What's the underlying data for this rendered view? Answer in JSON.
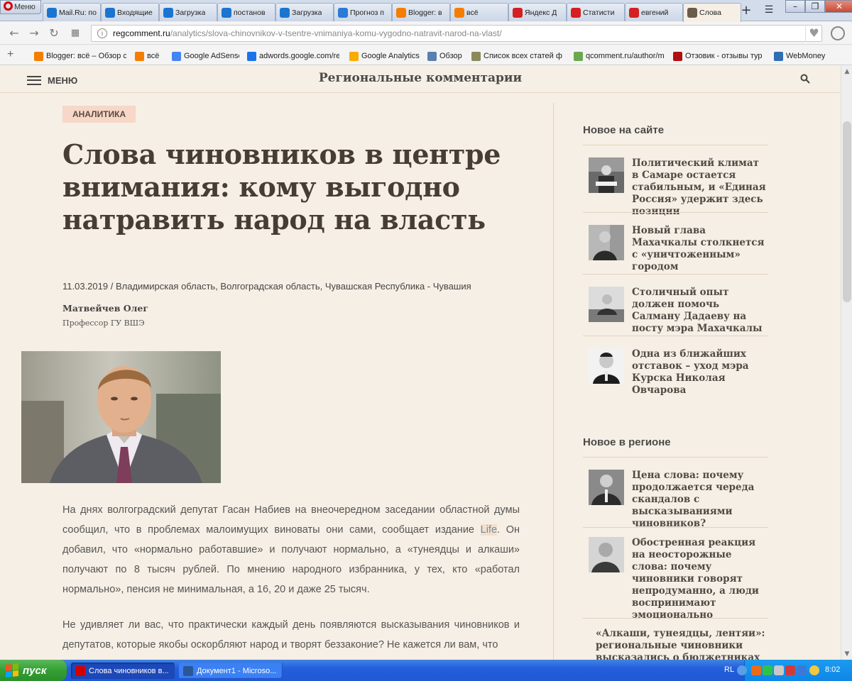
{
  "browser": {
    "menu_label": "Меню",
    "tabs": [
      {
        "label": "Mail.Ru: по",
        "icon": "mail-at-icon",
        "color": "#1b75d0"
      },
      {
        "label": "Входящие",
        "icon": "mail-at-icon",
        "color": "#1b75d0"
      },
      {
        "label": "Загрузка",
        "icon": "mail-at-icon",
        "color": "#1b75d0"
      },
      {
        "label": "постанов",
        "icon": "mail-at-icon",
        "color": "#1b75d0"
      },
      {
        "label": "Загрузка",
        "icon": "mail-at-icon",
        "color": "#1b75d0"
      },
      {
        "label": "Прогноз п",
        "icon": "weather-icon",
        "color": "#2a7ad8"
      },
      {
        "label": "Blogger: в",
        "icon": "blogger-icon",
        "color": "#f57d00"
      },
      {
        "label": "всё",
        "icon": "blogger-icon",
        "color": "#f57d00"
      },
      {
        "label": "Яндекс Д",
        "icon": "yandex-icon",
        "color": "#d42020"
      },
      {
        "label": "Статисти",
        "icon": "yandex-icon",
        "color": "#d42020"
      },
      {
        "label": "евгений",
        "icon": "yandex-icon",
        "color": "#d42020"
      },
      {
        "label": "Слова",
        "icon": "rk-site-icon",
        "color": "#6b5b4b"
      }
    ],
    "url_host": "regcomment.ru",
    "url_path": "/analytics/slova-chinovnikov-v-tsentre-vnimaniya-komu-vygodno-natravit-narod-na-vlast/",
    "bookmarks": [
      {
        "label": "Blogger: всё – Обзор ст",
        "icon": "blogger-icon",
        "color": "#f57d00"
      },
      {
        "label": "всё",
        "icon": "blogger-icon",
        "color": "#f57d00"
      },
      {
        "label": "Google AdSense",
        "icon": "adsense-icon",
        "color": "#4285f4"
      },
      {
        "label": "adwords.google.com/re",
        "icon": "adwords-icon",
        "color": "#1a73e8"
      },
      {
        "label": "Google Analytics",
        "icon": "analytics-icon",
        "color": "#f9ab00"
      },
      {
        "label": "Обзор",
        "icon": "overview-icon",
        "color": "#5a7fb0"
      },
      {
        "label": "Список всех статей ф",
        "icon": "list-icon",
        "color": "#8a8a5a"
      },
      {
        "label": "qcomment.ru/author/m",
        "icon": "qcomment-icon",
        "color": "#6aa84f"
      },
      {
        "label": "Отзовик - отзывы тур",
        "icon": "otzovik-icon",
        "color": "#b01010"
      },
      {
        "label": "WebMoney",
        "icon": "webmoney-icon",
        "color": "#2f6db5"
      }
    ]
  },
  "site": {
    "menu_label": "МЕНЮ",
    "title": "Региональные комментарии"
  },
  "article": {
    "category": "АНАЛИТИКА",
    "title": "Слова чиновников в центре внимания: кому выгодно натравить народ на власть",
    "date": "11.03.2019",
    "regions": "Владимирская область, Волгоградская область, Чувашская Республика - Чувашия",
    "author_name": "Матвейчев Олег",
    "author_role": "Профессор ГУ ВШЭ",
    "para1_before": "На днях волгоградский депутат Гасан Набиев на внеочередном заседании областной думы сообщил, что в проблемах малоимущих виноваты они сами, сообщает издание ",
    "para1_link": "Life",
    "para1_after": ". Он добавил, что «нормально работавшие» и получают нормально, а «тунеядцы и алкаши» получают по 8 тысяч рублей. По мнению народного избранника, у тех, кто «работал нормально», пенсия не минимальная, а 16, 20 и даже 25 тысяч.",
    "para2": "Не удивляет ли вас, что практически каждый день появляются высказывания чиновников и депутатов, которые якобы оскорбляют народ и творят беззаконие? Не кажется ли вам, что"
  },
  "sidebar": {
    "new_on_site_heading": "Новое на сайте",
    "new_on_site": [
      "Политический климат в Самаре остается стабильным, и «Единая Россия» удержит здесь позиции",
      "Новый глава Махачкалы столкнется с «уничтоженным» городом",
      "Столичный опыт должен помочь Салману Дадаеву на посту мэра Махачкалы",
      "Одна из ближайших отставок – уход мэра Курска Николая Овчарова"
    ],
    "new_in_region_heading": "Новое в регионе",
    "new_in_region": [
      "Цена слова: почему продолжается череда скандалов с высказываниями чиновников?",
      "Обостренная реакция на неосторожные слова: почему чиновники говорят непродуманно, а люди воспринимают эмоционально"
    ],
    "last_item": "«Алкаши, тунеядцы, лентяи»: региональные чиновники высказались о бюджетниках и ма-"
  },
  "taskbar": {
    "start_label": "пуск",
    "tasks": [
      {
        "label": "Слова чиновников в...",
        "icon": "opera-icon",
        "color": "#d40000"
      },
      {
        "label": "Документ1 - Microso...",
        "icon": "word-icon",
        "color": "#2b5797"
      }
    ],
    "lang": "RL",
    "clock": "8:02"
  }
}
